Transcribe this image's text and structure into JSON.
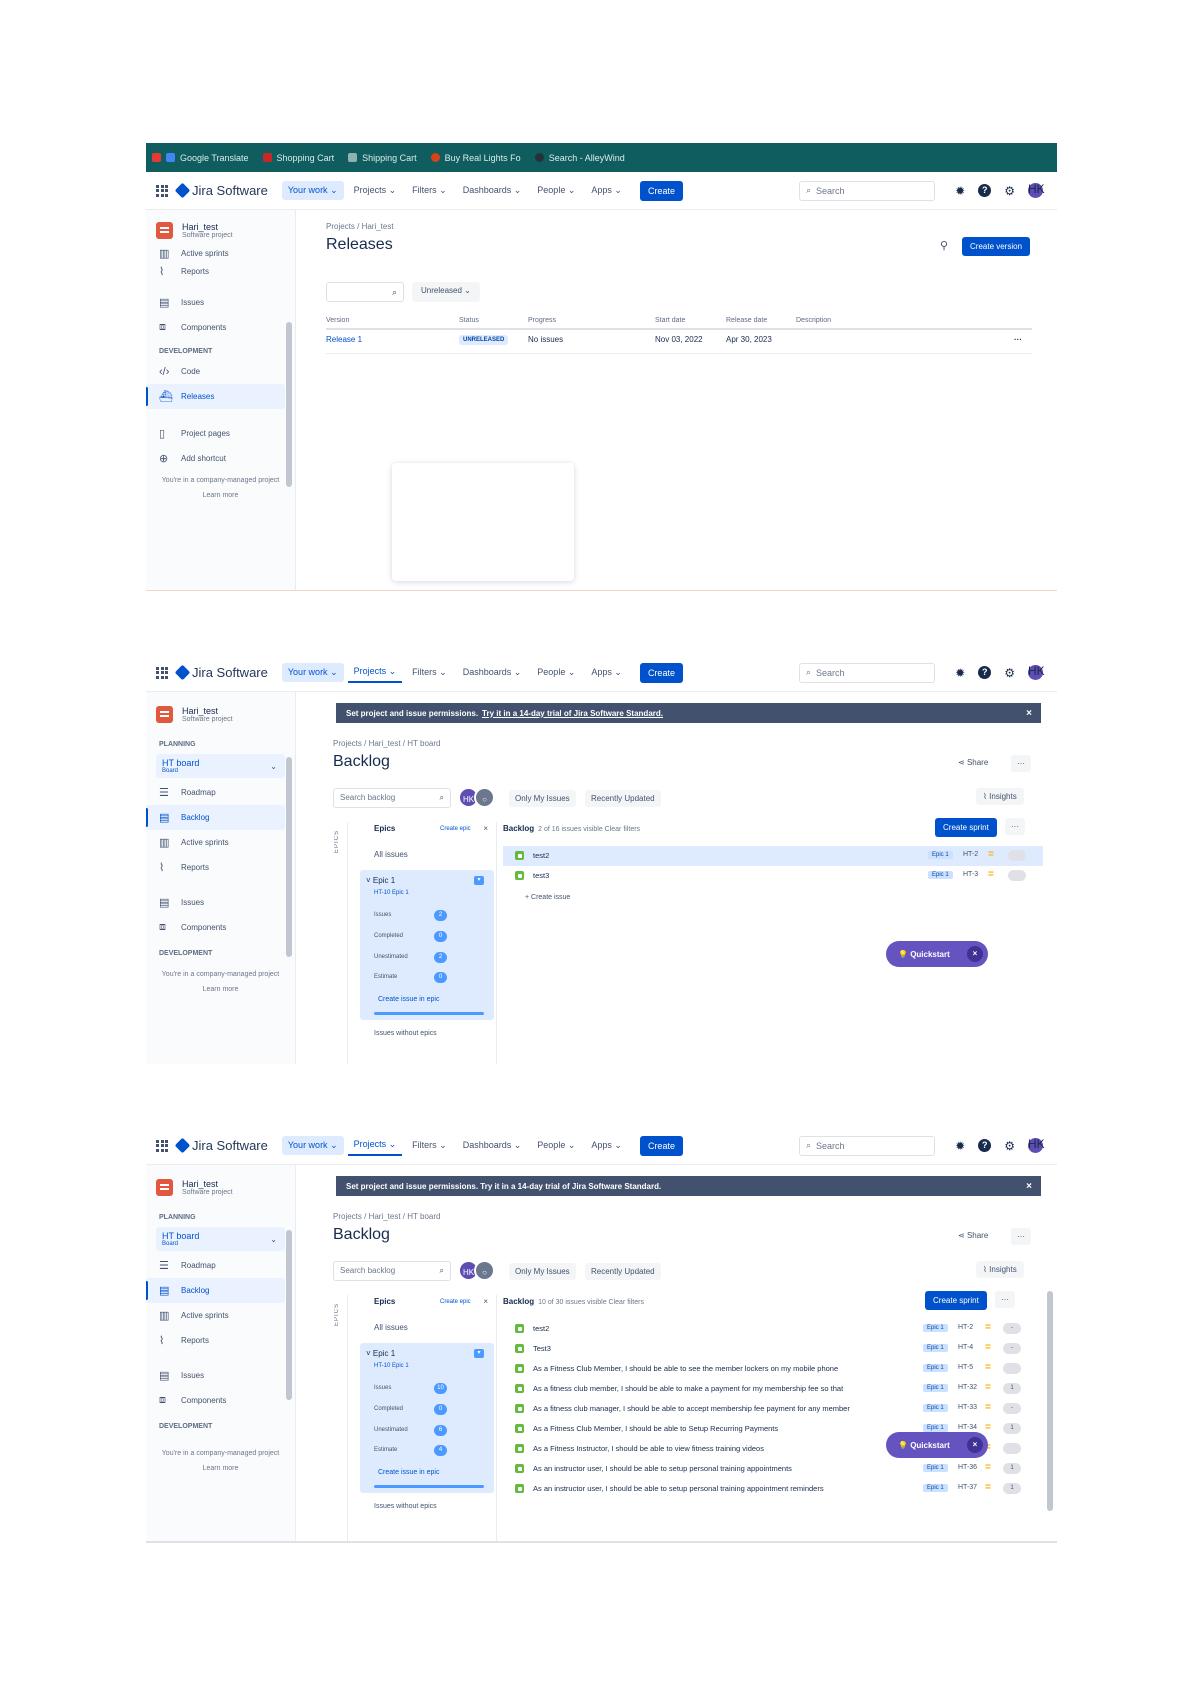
{
  "common": {
    "app_name": "Jira Software",
    "nav": [
      "Your work",
      "Projects",
      "Filters",
      "Dashboards",
      "People",
      "Apps"
    ],
    "create": "Create",
    "search_placeholder": "Search",
    "avatar_initials": "HK",
    "project_name": "Hari_test",
    "project_type": "Software project",
    "company_note": "You're in a company-managed project",
    "learn_more": "Learn more",
    "development": "DEVELOPMENT",
    "planning": "PLANNING"
  },
  "bookmarks": [
    "Google Translate",
    "Shopping Cart",
    "Shipping Cart",
    "Buy Real Lights Fo",
    "Search - AlleyWind"
  ],
  "screen1": {
    "sidebar": [
      "Active sprints",
      "Reports",
      "Issues",
      "Components",
      "Code",
      "Releases",
      "Project pages",
      "Add shortcut"
    ],
    "breadcrumb": "Projects  /  Hari_test",
    "title": "Releases",
    "create_version": "Create version",
    "filter_dd": "Unreleased",
    "cols": [
      "Version",
      "Status",
      "Progress",
      "Start date",
      "Release date",
      "Description"
    ],
    "row": {
      "version": "Release 1",
      "status": "UNRELEASED",
      "progress": "No issues",
      "start": "Nov 03, 2022",
      "release": "Apr 30, 2023"
    }
  },
  "backlog": {
    "sidebar_board": "HT board",
    "sidebar_board_sub": "Board",
    "sidebar": [
      "Roadmap",
      "Backlog",
      "Active sprints",
      "Reports",
      "Issues",
      "Components"
    ],
    "banner_text": "Set project and issue permissions.",
    "banner_link": "Try it in a 14-day trial of Jira Software Standard.",
    "breadcrumb": "Projects  /  Hari_test  /  HT board",
    "title": "Backlog",
    "share": "Share",
    "search_placeholder": "Search backlog",
    "only_my": "Only My Issues",
    "recent": "Recently Updated",
    "insights": "Insights",
    "create_sprint": "Create sprint",
    "epics_tab": "EPICS",
    "epics_title": "Epics",
    "create_epic": "Create epic",
    "all_issues": "All issues",
    "epic_name": "Epic 1",
    "epic_key": "HT-10 Epic 1",
    "stat_labels": [
      "Issues",
      "Completed",
      "Unestimated",
      "Estimate"
    ],
    "create_in_epic": "Create issue in epic",
    "issues_without": "Issues without epics",
    "backlog_label": "Backlog",
    "quickstart": "Quickstart",
    "create_issue": "+ Create issue"
  },
  "screen2": {
    "stats": [
      "2",
      "0",
      "2",
      "0"
    ],
    "count_text": "2 of 16 issues visible   Clear filters",
    "issues": [
      {
        "summary": "test2",
        "epic": "Epic 1",
        "key": "HT-2"
      },
      {
        "summary": "test3",
        "epic": "Epic 1",
        "key": "HT-3"
      }
    ]
  },
  "screen3": {
    "stats": [
      "10",
      "0",
      "6",
      "4"
    ],
    "count_text": "10 of 30 issues visible   Clear filters",
    "issues": [
      {
        "summary": "test2",
        "epic": "Epic 1",
        "key": "HT-2",
        "est": "-"
      },
      {
        "summary": "Test3",
        "epic": "Epic 1",
        "key": "HT-4",
        "est": "-"
      },
      {
        "summary": "As a Fitness Club Member, I should be able to see the member lockers on my mobile phone",
        "epic": "Epic 1",
        "key": "HT-5",
        "est": ""
      },
      {
        "summary": "As a fitness club member, I should be able to make a payment for my membership fee so that",
        "epic": "Epic 1",
        "key": "HT-32",
        "est": "1"
      },
      {
        "summary": "As a fitness club manager, I should be able to accept membership fee payment for any member",
        "epic": "Epic 1",
        "key": "HT-33",
        "est": "-"
      },
      {
        "summary": "As a Fitness Club Member, I should be able to Setup Recurring Payments",
        "epic": "Epic 1",
        "key": "HT-34",
        "est": "1"
      },
      {
        "summary": "As a Fitness Instructor, I should be able to view fitness training videos",
        "epic": "Epic 1",
        "key": "HT-35",
        "est": ""
      },
      {
        "summary": "As an instructor user, I should be able to setup personal training appointments",
        "epic": "Epic 1",
        "key": "HT-36",
        "est": "1"
      },
      {
        "summary": "As an instructor user, I should be able to setup personal training appointment reminders",
        "epic": "Epic 1",
        "key": "HT-37",
        "est": "1"
      }
    ]
  }
}
